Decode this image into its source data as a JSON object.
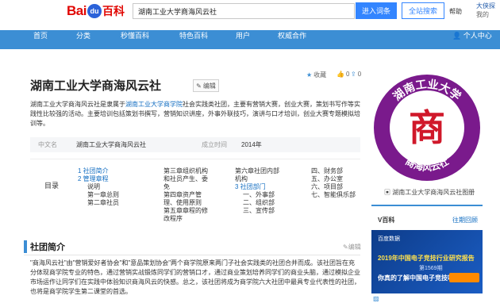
{
  "header": {
    "logo_bai": "Bai",
    "logo_du": "du",
    "logo_baike": "百科",
    "search_value": "湖南工业大学商海风云社",
    "enter_entry_label": "进入词条",
    "search_label": "全站搜索",
    "help_label": "帮助",
    "user_name": "大侠探",
    "user_sub": "我的"
  },
  "nav": {
    "items": [
      "首页",
      "分类",
      "秒懂百科",
      "特色百科",
      "用户",
      "权威合作"
    ],
    "user_center": "个人中心"
  },
  "entry": {
    "title": "湖南工业大学商海风云社",
    "edit_label": "编辑",
    "collect_label": "收藏",
    "like_count": "0",
    "share_count": "0",
    "summary_before": "湖南工业大学商海风云社是隶属于",
    "summary_link": "湖南工业大学商学院",
    "summary_after": "社会实践类社团，主要有营销大赛，创业大赛，策划书写作等实践性比较强的活动。主要培训包括策划书撰写，营销知识讲座，外事外联技巧，演讲与口才培训，创业大赛专题模拟培训等。",
    "info": [
      {
        "key": "中文名",
        "value": "湖南工业大学商海风云社"
      },
      {
        "key": "成立时间",
        "value": "2014年"
      }
    ]
  },
  "toc": {
    "label": "目录",
    "col1": [
      "1  社团简介",
      "2  管理章程",
      "说明",
      "第一章总则",
      "第二章社员"
    ],
    "col2": [
      "第三章组织机构",
      "和社员产生、委",
      "免",
      "第四章资产管",
      "理、使用原则",
      "第五章章程的修",
      "改程序"
    ],
    "col3": [
      "第六章社团内部",
      "机构",
      "3  社团部门",
      "一、外事部",
      "二、组织部",
      "三、宣传部"
    ],
    "col4": [
      "四、财务部",
      "五、办公室",
      "六、项目部",
      "七、智能俱乐部"
    ]
  },
  "section": {
    "title": "社团简介",
    "edit_label": "编辑",
    "body": "\"商海风云社\"由\"营销爱好者协会\"和\"意品策划协会\"两个商学院原来两门子社会实践类的社团合并而成。该社团旨在充分体现商学院专业的特色，通过营销实战锻炼同学们的营销口才，通过商业策划培养同学们的商业头脑，通过模拟企业市场运作让同学们在实践中体验知识商海风云的快感。总之，该社团将成为商学院六大社团中最具专业代表性的社团，也将是商学院学生第二课堂的首选。"
  },
  "sidebar": {
    "logo_text_top": "湖南工业大学",
    "logo_text_bottom": "商海风云社",
    "logo_char": "商",
    "album_caption": "湖南工业大学商海风云社图册",
    "vbaike_label": "V百科",
    "vbaike_more": "往期回顾",
    "ad_brand": "百度数据",
    "ad_title": "2019年中国电子竞技行业研究报告",
    "ad_count": "第1569期",
    "ad_question": "你真的了解中国电子竞技吗?"
  }
}
